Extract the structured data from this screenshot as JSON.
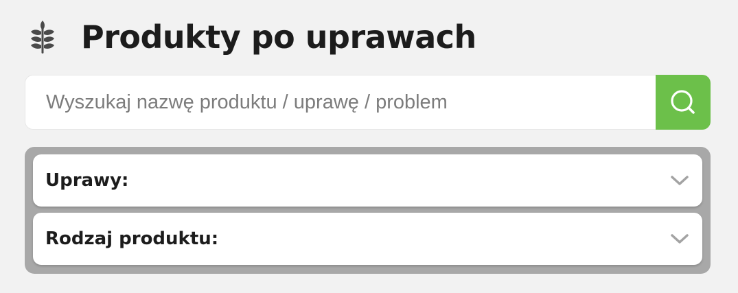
{
  "header": {
    "title": "Produkty po uprawach",
    "icon": "wheat-icon"
  },
  "search": {
    "placeholder": "Wyszukaj nazwę produktu / uprawę / problem",
    "value": "",
    "button_icon": "search-icon"
  },
  "filters": [
    {
      "label": "Uprawy:",
      "icon": "chevron-down-icon"
    },
    {
      "label": "Rodzaj produktu:",
      "icon": "chevron-down-icon"
    }
  ],
  "colors": {
    "background": "#f2f2f2",
    "accent": "#6cc04a",
    "filters_panel": "#a8a8a8",
    "text": "#1c1c1c",
    "icon": "#4a4a4a"
  }
}
